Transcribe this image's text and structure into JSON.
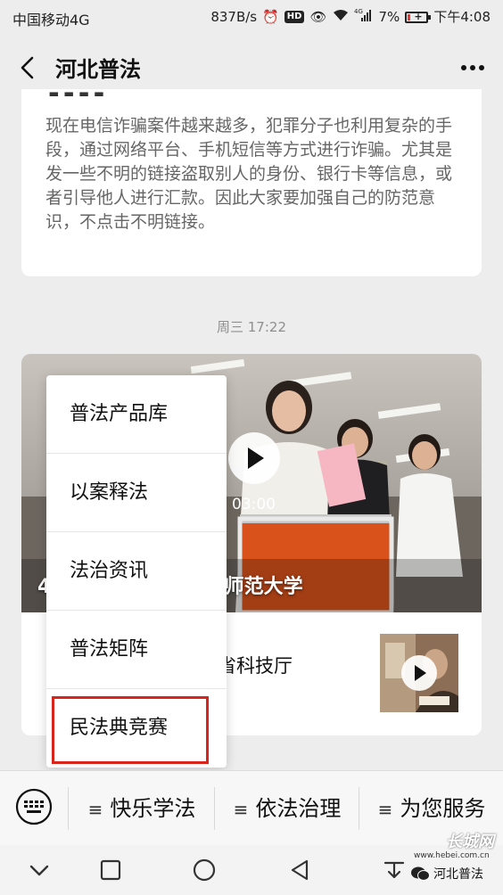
{
  "status_bar": {
    "carrier": "中国移动4G",
    "speed": "837B/s",
    "hd": "HD",
    "network": "4G",
    "battery": "7%",
    "time": "下午4:08"
  },
  "header": {
    "title": "河北普法",
    "back_icon": "chevron-left-icon",
    "more_icon": "more-dots-icon"
  },
  "article": {
    "text": "现在电信诈骗案件越来越多，犯罪分子也利用复杂的手段，通过网络平台、手机短信等方式进行诈骗。尤其是发一些不明的链接盗取别人的身份、银行卡等信息，或者引导他人进行汇款。因此大家要加强自己的防范意识，不点击不明链接。"
  },
  "timestamp": "周三 17:22",
  "video": {
    "caption": "4……行-讲述类-河北师范大学",
    "duration": "03:00",
    "sub_title": "省科技厅"
  },
  "popup_menu": {
    "items": [
      {
        "label": "普法产品库"
      },
      {
        "label": "以案释法"
      },
      {
        "label": "法治资讯"
      },
      {
        "label": "普法矩阵"
      },
      {
        "label": "民法典竞赛"
      }
    ],
    "highlight_color": "#d9241b"
  },
  "menu_bar": {
    "items": [
      {
        "label": "快乐学法"
      },
      {
        "label": "依法治理"
      },
      {
        "label": "为您服务"
      }
    ]
  },
  "watermark": {
    "site": "长城网",
    "url": "www.hebei.com.cn",
    "account": "河北普法"
  }
}
